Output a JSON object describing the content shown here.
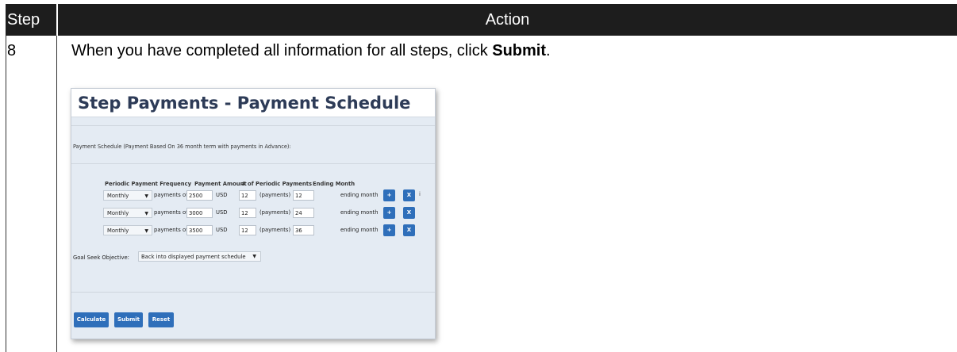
{
  "table": {
    "header_step": "Step",
    "header_action": "Action",
    "step_number": "8",
    "instruction_prefix": "When you have completed all information for all steps, click ",
    "instruction_bold": "Submit",
    "instruction_suffix": "."
  },
  "screenshot": {
    "title": "Step Payments - Payment Schedule",
    "schedule_label": "Payment Schedule (Payment Based On 36 month term with payments in Advance):",
    "columns": {
      "frequency": "Periodic Payment Frequency",
      "amount": "Payment Amount",
      "count": "# of Periodic Payments",
      "ending": "Ending Month"
    },
    "rows": [
      {
        "frequency": "Monthly",
        "payments_of": "payments of",
        "amount": "2500",
        "currency": "USD",
        "count": "12",
        "count_unit": "(payments)",
        "ending": "12",
        "ending_label": "ending month",
        "add": "+",
        "remove": "X"
      },
      {
        "frequency": "Monthly",
        "payments_of": "payments of",
        "amount": "3000",
        "currency": "USD",
        "count": "12",
        "count_unit": "(payments)",
        "ending": "24",
        "ending_label": "ending month",
        "add": "+",
        "remove": "X"
      },
      {
        "frequency": "Monthly",
        "payments_of": "payments of",
        "amount": "3500",
        "currency": "USD",
        "count": "12",
        "count_unit": "(payments)",
        "ending": "36",
        "ending_label": "ending month",
        "add": "+",
        "remove": "X"
      }
    ],
    "info_glyph": "i",
    "goal_seek_label": "Goal Seek Objective:",
    "goal_seek_value": "Back into displayed payment schedule",
    "buttons": {
      "calculate": "Calculate",
      "submit": "Submit",
      "reset": "Reset"
    },
    "colors": {
      "accent": "#2f6fba",
      "title": "#2d3b57",
      "panel": "#e4ebf3"
    }
  }
}
